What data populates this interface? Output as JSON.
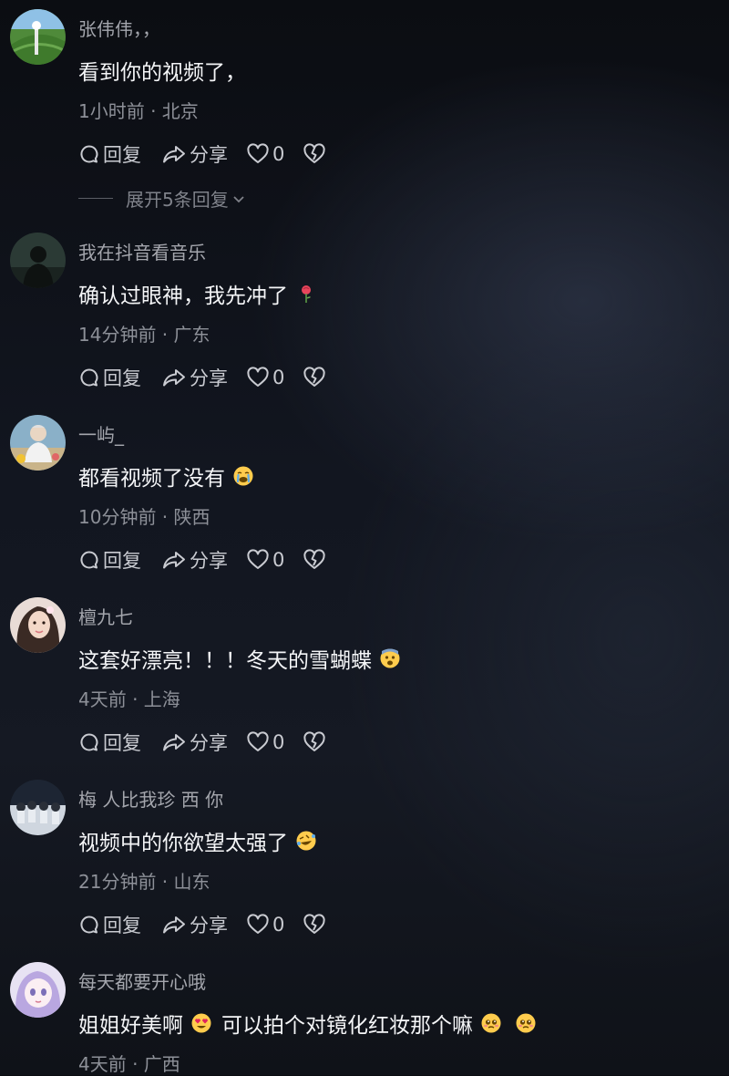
{
  "comments": [
    {
      "username": "张伟伟，，",
      "text": "看到你的视频了，",
      "meta": "1小时前 · 北京",
      "actions": {
        "reply": "回复",
        "share": "分享",
        "likes": "0"
      },
      "expand": "展开5条回复"
    },
    {
      "username": "我在抖音看音乐",
      "text": "确认过眼神，我先冲了",
      "meta": "14分钟前 · 广东",
      "actions": {
        "reply": "回复",
        "share": "分享",
        "likes": "0"
      }
    },
    {
      "username": "一屿_",
      "text": "都看视频了没有",
      "meta": "10分钟前 · 陕西",
      "actions": {
        "reply": "回复",
        "share": "分享",
        "likes": "0"
      }
    },
    {
      "username": "檀九七",
      "text": "这套好漂亮！！！冬天的雪蝴蝶",
      "meta": "4天前 · 上海",
      "actions": {
        "reply": "回复",
        "share": "分享",
        "likes": "0"
      }
    },
    {
      "username": "梅 人比我珍 西 你",
      "text": "视频中的你欲望太强了",
      "meta": "21分钟前 · 山东",
      "actions": {
        "reply": "回复",
        "share": "分享",
        "likes": "0"
      }
    },
    {
      "username": "每天都要开心哦",
      "text_a": "姐姐好美啊",
      "text_b": "可以拍个对镜化红妆那个嘛",
      "meta": "4天前 · 广西"
    }
  ]
}
